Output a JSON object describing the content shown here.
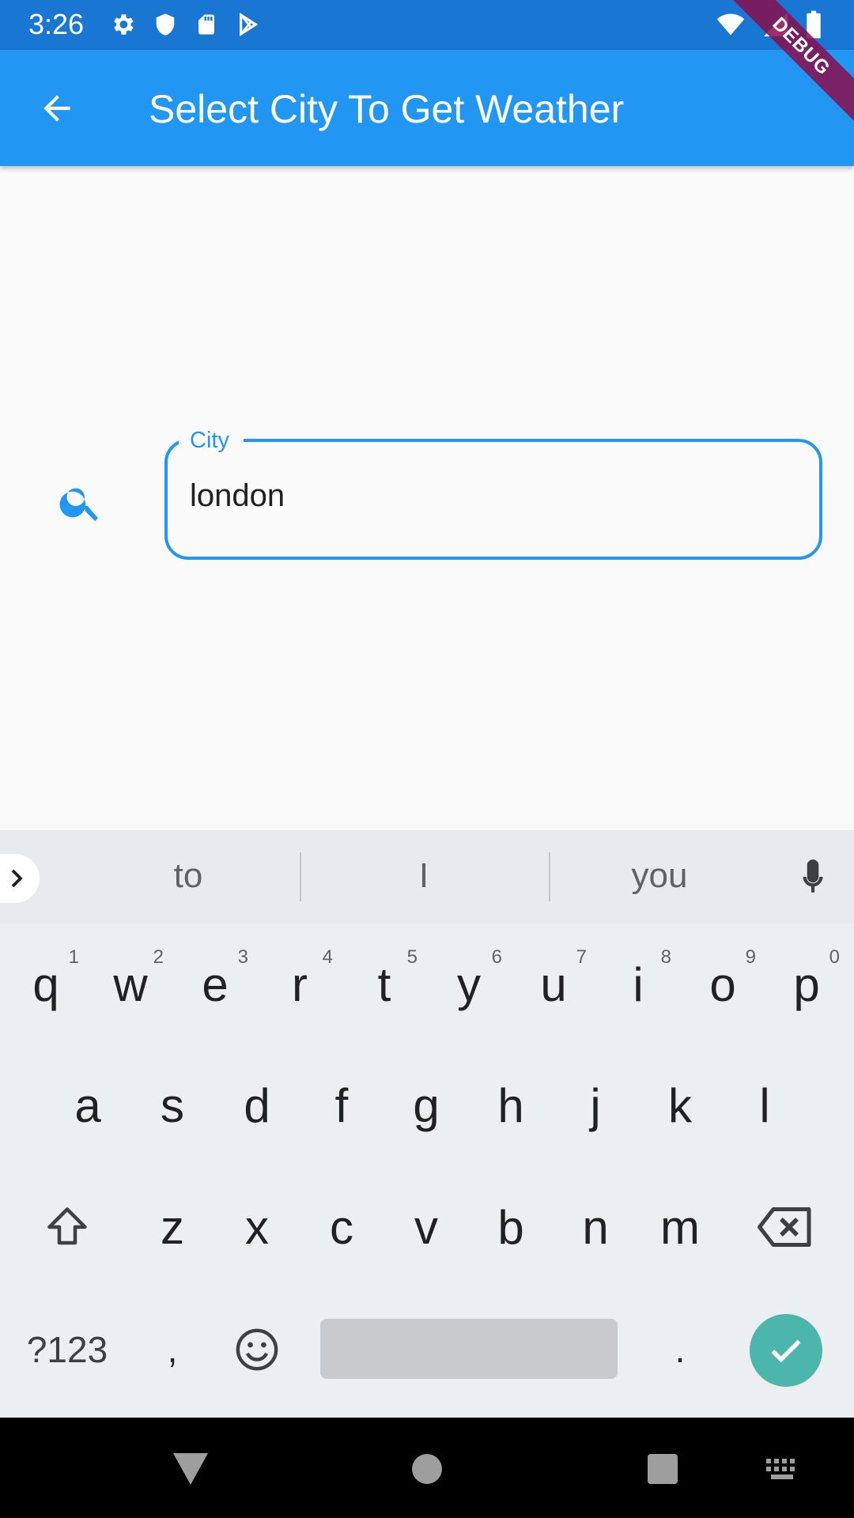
{
  "status_bar": {
    "time": "3:26",
    "icons_left": [
      "settings-icon",
      "shield-icon",
      "sd-card-icon",
      "play-store-icon"
    ],
    "icons_right": [
      "wifi-icon",
      "signal-icon",
      "battery-icon"
    ]
  },
  "debug_banner": "DEBUG",
  "app_bar": {
    "title": "Select City To Get Weather",
    "back_icon": "arrow-back-icon",
    "color": "#2196f3"
  },
  "city_field": {
    "label": "City",
    "value": "london",
    "icon": "search-icon",
    "accent": "#2196f3"
  },
  "keyboard": {
    "suggestions": [
      "to",
      "I",
      "you"
    ],
    "row1": [
      {
        "key": "q",
        "hint": "1"
      },
      {
        "key": "w",
        "hint": "2"
      },
      {
        "key": "e",
        "hint": "3"
      },
      {
        "key": "r",
        "hint": "4"
      },
      {
        "key": "t",
        "hint": "5"
      },
      {
        "key": "y",
        "hint": "6"
      },
      {
        "key": "u",
        "hint": "7"
      },
      {
        "key": "i",
        "hint": "8"
      },
      {
        "key": "o",
        "hint": "9"
      },
      {
        "key": "p",
        "hint": "0"
      }
    ],
    "row2": [
      "a",
      "s",
      "d",
      "f",
      "g",
      "h",
      "j",
      "k",
      "l"
    ],
    "row3": [
      "z",
      "x",
      "c",
      "v",
      "b",
      "n",
      "m"
    ],
    "symbols_key": "?123",
    "comma_key": ",",
    "period_key": ".",
    "enter_color": "#4db6ac"
  }
}
